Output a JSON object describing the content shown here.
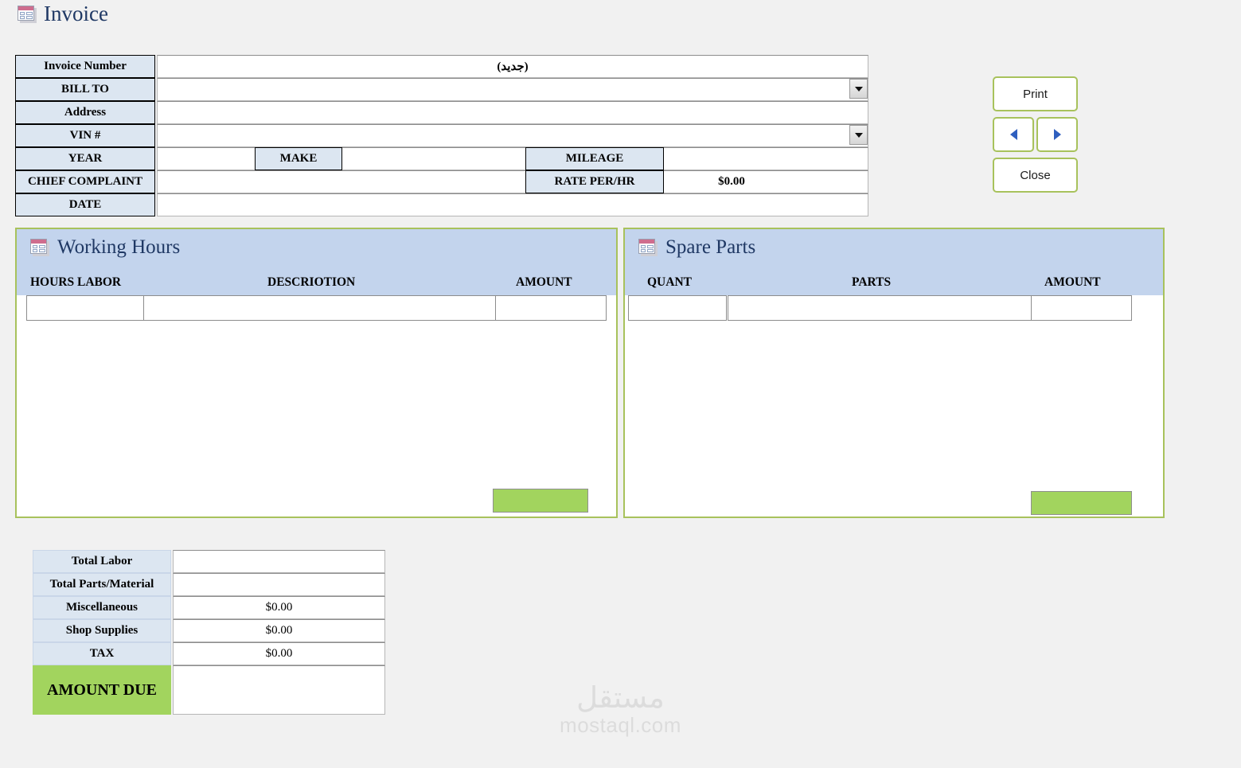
{
  "window": {
    "title": "Invoice",
    "icon": "form-icon"
  },
  "header_form": {
    "rows": [
      {
        "label": "Invoice Number",
        "value": "(جديد)",
        "dropdown": false
      },
      {
        "label": "BILL TO",
        "value": "",
        "dropdown": true
      },
      {
        "label": "Address",
        "value": "",
        "dropdown": false
      },
      {
        "label": "VIN #",
        "value": "",
        "dropdown": true
      },
      {
        "label": "YEAR",
        "value": "",
        "dropdown": false
      },
      {
        "label": "CHIEF COMPLAINT",
        "value": "",
        "dropdown": false
      },
      {
        "label": "DATE",
        "value": "",
        "dropdown": false
      }
    ],
    "inline_labels": {
      "make": "MAKE",
      "mileage": "MILEAGE",
      "rate_per_hr": "RATE PER/HR",
      "rate_per_hr_value": "$0.00"
    }
  },
  "side_buttons": {
    "print": "Print",
    "previous": "◀",
    "next": "▶",
    "close": "Close"
  },
  "working_hours": {
    "title": "Working Hours",
    "columns": [
      "HOURS LABOR",
      "DESCRIOTION",
      "AMOUNT"
    ],
    "rows": [
      {
        "hours_labor": "",
        "description": "",
        "amount": ""
      }
    ],
    "total": ""
  },
  "spare_parts": {
    "title": "Spare Parts",
    "columns": [
      "QUANT",
      "PARTS",
      "AMOUNT"
    ],
    "rows": [
      {
        "quant": "",
        "parts": "",
        "amount": ""
      }
    ],
    "total": ""
  },
  "totals": {
    "rows": [
      {
        "label": "Total Labor",
        "value": ""
      },
      {
        "label": "Total Parts/Material",
        "value": ""
      },
      {
        "label": "Miscellaneous",
        "value": "$0.00"
      },
      {
        "label": "Shop Supplies",
        "value": "$0.00"
      },
      {
        "label": "TAX",
        "value": "$0.00"
      }
    ],
    "amount_due": {
      "label": "AMOUNT DUE",
      "value": ""
    }
  },
  "watermark": {
    "arabic": "مستقل",
    "latin": "mostaql.com"
  },
  "colors": {
    "label_blue": "#dce6f1",
    "subform_header_blue": "#c3d4ed",
    "accent_green": "#a2d45e",
    "button_border_green": "#a8c25c",
    "title_navy": "#1f3864",
    "page_bg": "#f1f1f1"
  }
}
